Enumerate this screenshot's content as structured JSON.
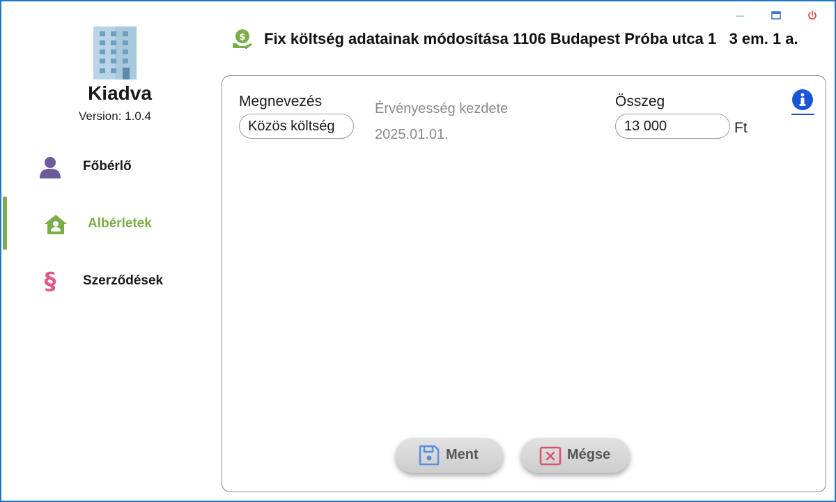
{
  "window": {
    "controls": {
      "minimize": "—",
      "maximize": "maximize-icon",
      "close": "power-icon"
    }
  },
  "app": {
    "name": "Kiadva",
    "version": "Version: 1.0.4"
  },
  "sidebar": {
    "items": [
      {
        "label": "Főbérlő",
        "icon": "person-icon",
        "active": false
      },
      {
        "label": "Albérletek",
        "icon": "house-person-icon",
        "active": true
      },
      {
        "label": "Szerződések",
        "icon": "paragraph-icon",
        "active": false
      }
    ]
  },
  "header": {
    "title": "Fix költség adatainak módosítása 1106 Budapest Próba utca 1   3 em. 1 a.",
    "icon": "money-hand-icon"
  },
  "form": {
    "name_label": "Megnevezés",
    "name_value": "Közös költség",
    "validity_label": "Érvényesség kezdete",
    "validity_value": "2025.01.01.",
    "amount_label": "Összeg",
    "amount_value": "13 000",
    "amount_unit": "Ft",
    "info_icon": "info-icon"
  },
  "buttons": {
    "save": "Ment",
    "cancel": "Mégse"
  },
  "colors": {
    "accent_green": "#7aae48",
    "person_purple": "#6b5b9a",
    "paragraph_pink": "#e0578a",
    "save_blue": "#5a8fe0",
    "cancel_red": "#d9506e",
    "info_blue": "#1a56d8",
    "window_border": "#1e78c8"
  }
}
